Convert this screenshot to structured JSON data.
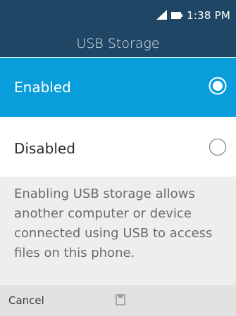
{
  "status_bar": {
    "time": "1:38 PM",
    "icons": [
      "signal-icon",
      "battery-icon"
    ]
  },
  "header": {
    "title": "USB Storage"
  },
  "options": [
    {
      "label": "Enabled",
      "selected": true
    },
    {
      "label": "Disabled",
      "selected": false
    }
  ],
  "info": {
    "text": "Enabling USB storage allows another computer or device connected using USB to access files on this phone."
  },
  "softkeys": {
    "left": "Cancel",
    "center_icon": "save-icon"
  },
  "colors": {
    "header": "#1f4664",
    "selected": "#0a9ddb",
    "info_bg": "#eeeeee",
    "softkey_bg": "#e2e2e2"
  }
}
